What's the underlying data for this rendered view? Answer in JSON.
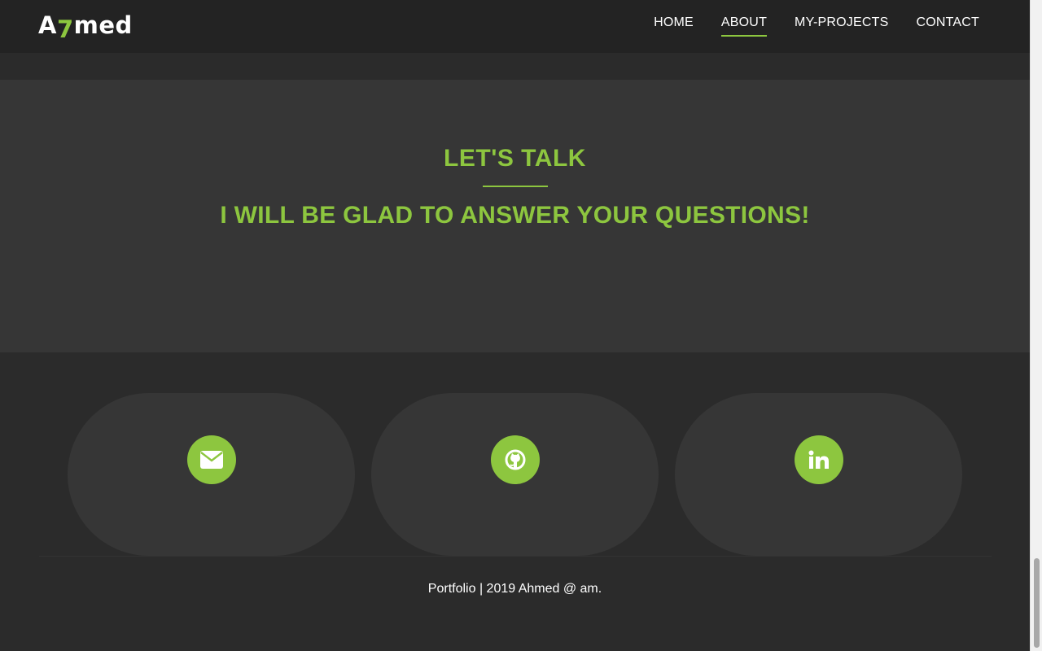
{
  "header": {
    "logo_prefix": "A",
    "logo_accent": "7",
    "logo_suffix": "med",
    "nav": [
      {
        "label": "HOME",
        "active": false
      },
      {
        "label": "ABOUT",
        "active": true
      },
      {
        "label": "MY-PROJECTS",
        "active": false
      },
      {
        "label": "CONTACT",
        "active": false
      }
    ]
  },
  "talk": {
    "title": "LET'S TALK",
    "subtitle": "I WILL BE GLAD TO ANSWER YOUR QUESTIONS!"
  },
  "contacts": [
    {
      "icon": "envelope-icon"
    },
    {
      "icon": "github-icon"
    },
    {
      "icon": "linkedin-icon"
    }
  ],
  "footer": {
    "text": "Portfolio | 2019 Ahmed @ am."
  },
  "colors": {
    "accent": "#8dc63f",
    "navbar_bg": "#232323",
    "section_bg": "#363636",
    "page_bg": "#2b2b2b"
  }
}
